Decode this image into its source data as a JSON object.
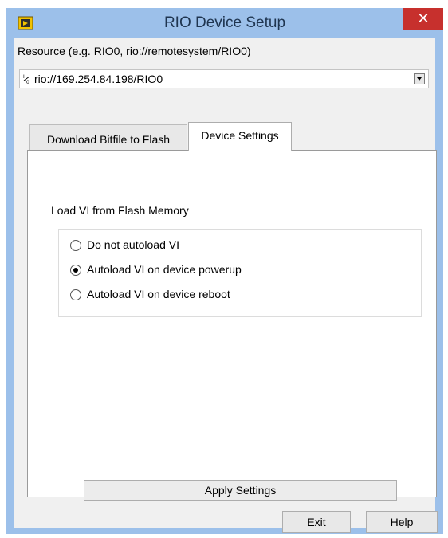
{
  "window": {
    "title": "RIO Device Setup",
    "close_label": "✕"
  },
  "resource": {
    "label": "Resource (e.g. RIO0, rio://remotesystem/RIO0)",
    "io_icon": "I/O",
    "value": "rio://169.254.84.198/RIO0"
  },
  "tabs": [
    {
      "label": "Download Bitfile to Flash",
      "selected": false
    },
    {
      "label": "Device Settings",
      "selected": true
    }
  ],
  "device_settings": {
    "group_label": "Load VI from Flash Memory",
    "options": [
      {
        "label": "Do not autoload VI",
        "checked": false
      },
      {
        "label": "Autoload VI on device powerup",
        "checked": true
      },
      {
        "label": "Autoload VI on device reboot",
        "checked": false
      }
    ],
    "apply_label": "Apply Settings"
  },
  "footer": {
    "exit_label": "Exit",
    "help_label": "Help"
  },
  "icons": {
    "app": "labview-app-icon",
    "close": "close-icon",
    "io": "io-resource-icon",
    "dropdown": "dropdown-arrow-icon"
  },
  "colors": {
    "title_bar": "#9cc0ea",
    "close_button": "#c7302d",
    "panel": "#f0f0f0"
  }
}
